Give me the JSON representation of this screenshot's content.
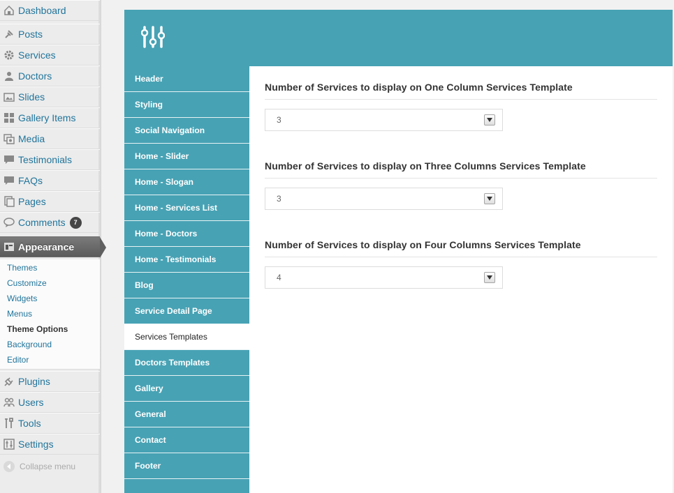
{
  "sidebar": {
    "items": [
      {
        "label": "Dashboard",
        "icon": "dashboard-icon"
      },
      {
        "label": "Posts",
        "icon": "pin-icon"
      },
      {
        "label": "Services",
        "icon": "gear-icon"
      },
      {
        "label": "Doctors",
        "icon": "users-icon"
      },
      {
        "label": "Slides",
        "icon": "image-icon"
      },
      {
        "label": "Gallery Items",
        "icon": "grid-icon"
      },
      {
        "label": "Media",
        "icon": "media-icon"
      },
      {
        "label": "Testimonials",
        "icon": "speech-bubble-icon"
      },
      {
        "label": "FAQs",
        "icon": "speech-bubble-icon"
      },
      {
        "label": "Pages",
        "icon": "pages-icon"
      },
      {
        "label": "Comments",
        "icon": "comment-icon",
        "badge": "7"
      },
      {
        "label": "Appearance",
        "icon": "appearance-icon"
      },
      {
        "label": "Plugins",
        "icon": "plugin-icon"
      },
      {
        "label": "Users",
        "icon": "users-icon"
      },
      {
        "label": "Tools",
        "icon": "tools-icon"
      },
      {
        "label": "Settings",
        "icon": "settings-icon"
      }
    ],
    "submenu": [
      "Themes",
      "Customize",
      "Widgets",
      "Menus",
      "Theme Options",
      "Background",
      "Editor"
    ],
    "collapse_label": "Collapse menu"
  },
  "tabs": [
    "Header",
    "Styling",
    "Social Navigation",
    "Home - Slider",
    "Home - Slogan",
    "Home - Services List",
    "Home - Doctors",
    "Home - Testimonials",
    "Blog",
    "Service Detail Page",
    "Services Templates",
    "Doctors Templates",
    "Gallery",
    "General",
    "Contact",
    "Footer"
  ],
  "active_tab": "Services Templates",
  "options": [
    {
      "title": "Number of Services to display on One Column Services Template",
      "value": "3"
    },
    {
      "title": "Number of Services to display on Three Columns Services Template",
      "value": "3"
    },
    {
      "title": "Number of Services to display on Four Columns Services Template",
      "value": "4"
    }
  ],
  "colors": {
    "accent": "#47a2b4",
    "link": "#21759b"
  }
}
